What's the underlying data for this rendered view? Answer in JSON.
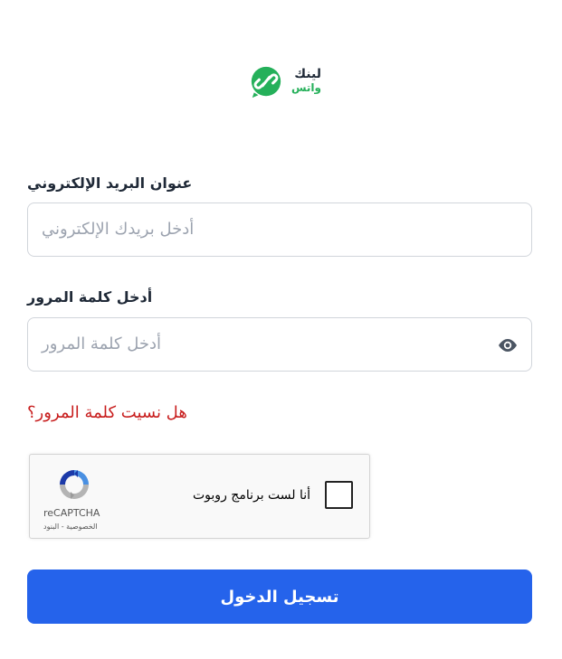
{
  "brand": {
    "line1": "لينك",
    "line2": "واتس",
    "color": "#25b05a"
  },
  "email": {
    "label": "عنوان البريد الإلكتروني",
    "placeholder": "أدخل بريدك الإلكتروني"
  },
  "password": {
    "label": "أدخل كلمة المرور",
    "placeholder": "أدخل كلمة المرور",
    "toggle_icon": "eye-icon"
  },
  "forgot": {
    "text": "هل نسيت كلمة المرور؟",
    "color": "#c81e1e"
  },
  "recaptcha": {
    "label": "أنا لست برنامج روبوت",
    "brand": "reCAPTCHA",
    "links": "الخصوصية - البنود"
  },
  "submit": {
    "label": "تسجيل الدخول",
    "color": "#2563eb"
  }
}
